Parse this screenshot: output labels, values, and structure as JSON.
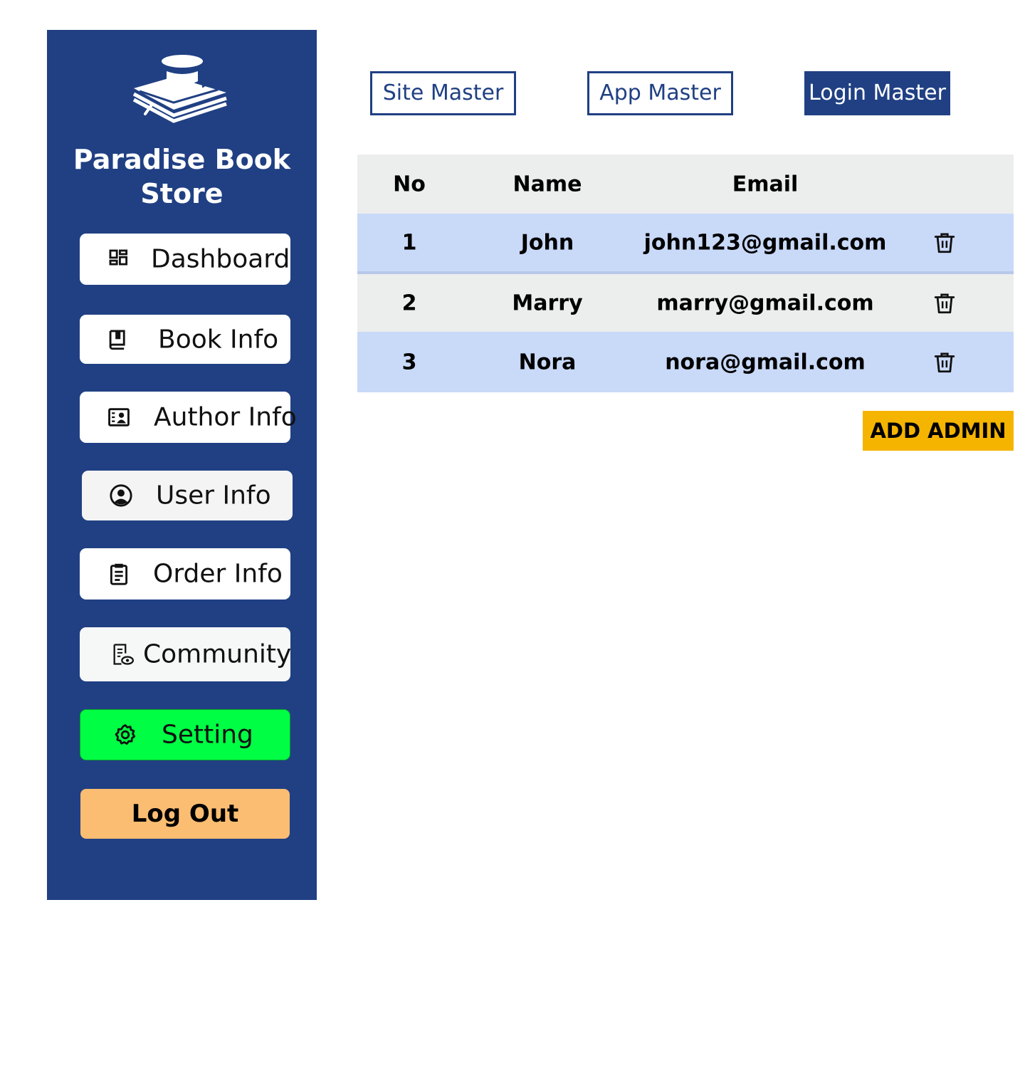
{
  "sidebar": {
    "brand": "Paradise Book Store",
    "logo_icon": "book-with-cup-icon",
    "items": [
      {
        "label": "Dashboard",
        "icon": "dashboard-grid-icon"
      },
      {
        "label": "Book Info",
        "icon": "book-icon"
      },
      {
        "label": "Author Info",
        "icon": "author-card-icon"
      },
      {
        "label": "User Info",
        "icon": "user-circle-icon"
      },
      {
        "label": "Order Info",
        "icon": "clipboard-list-icon"
      },
      {
        "label": "Community",
        "icon": "document-view-icon"
      },
      {
        "label": "Setting",
        "icon": "gear-icon",
        "active": true
      }
    ],
    "logout_label": "Log Out"
  },
  "tabs": [
    {
      "label": "Site Master",
      "active": false
    },
    {
      "label": "App Master",
      "active": false
    },
    {
      "label": "Login Master",
      "active": true
    }
  ],
  "table": {
    "headers": [
      "No",
      "Name",
      "Email"
    ],
    "rows": [
      {
        "no": "1",
        "name": "John",
        "email": "john123@gmail.com"
      },
      {
        "no": "2",
        "name": "Marry",
        "email": "marry@gmail.com"
      },
      {
        "no": "3",
        "name": "Nora",
        "email": "nora@gmail.com"
      }
    ],
    "delete_icon": "trash-icon"
  },
  "add_admin_label": "ADD ADMIN",
  "colors": {
    "sidebar_bg": "#204083",
    "setting_active": "#00ff44",
    "logout_bg": "#fbbd72",
    "add_admin_bg": "#f5b400",
    "row_highlight": "#c9d9f8",
    "row_plain": "#eceeed"
  }
}
